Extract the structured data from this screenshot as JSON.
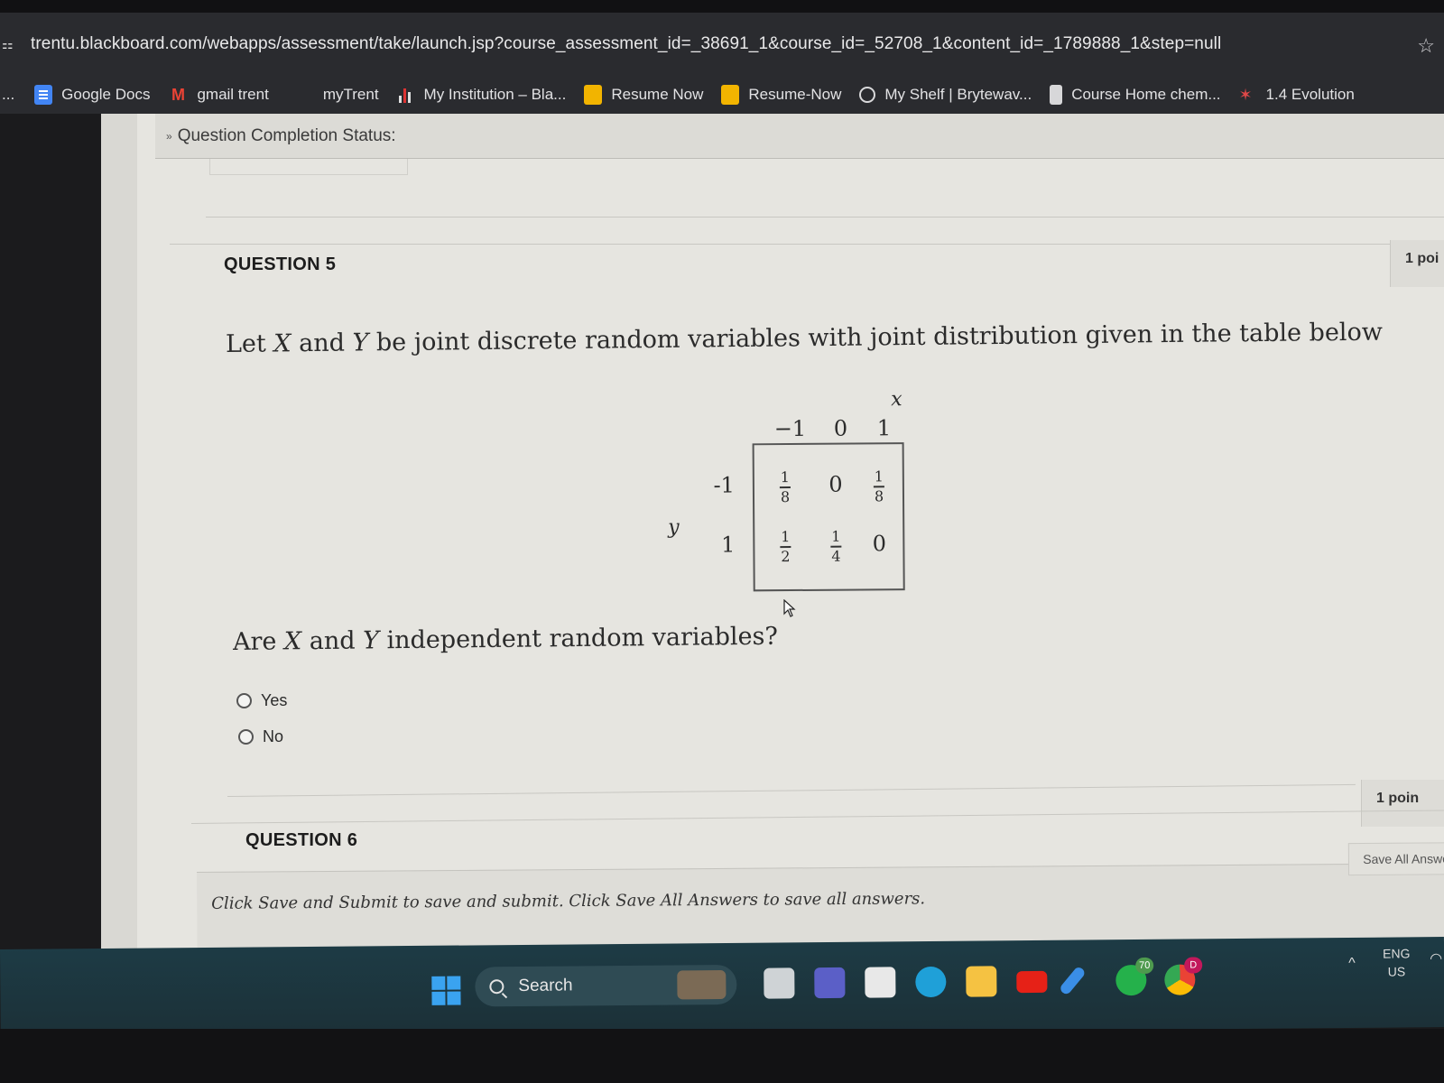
{
  "browser": {
    "url": "trentu.blackboard.com/webapps/assessment/take/launch.jsp?course_assessment_id=_38691_1&course_id=_52708_1&content_id=_1789888_1&step=null",
    "overflow_label": "..."
  },
  "bookmarks": [
    {
      "label": "Google Docs",
      "icon": "docs-icon"
    },
    {
      "label": "gmail trent",
      "icon": "gmail-icon"
    },
    {
      "label": "myTrent",
      "icon": ""
    },
    {
      "label": "My Institution – Bla...",
      "icon": "bars-icon"
    },
    {
      "label": "Resume Now",
      "icon": "resume-icon"
    },
    {
      "label": "Resume-Now",
      "icon": "resume-icon"
    },
    {
      "label": "My Shelf | Brytewav...",
      "icon": "globe-icon"
    },
    {
      "label": "Course Home chem...",
      "icon": "doc-icon"
    },
    {
      "label": "1.4 Evolution",
      "icon": "red-icon"
    }
  ],
  "page": {
    "status_label": "Question Completion Status:",
    "question5": {
      "heading": "QUESTION 5",
      "points": "1 poi",
      "prompt_parts": [
        "Let ",
        "X",
        " and ",
        "Y",
        " be joint discrete random variables with joint distribution given in the table below"
      ],
      "question_parts": [
        "Are ",
        "X",
        " and ",
        "Y",
        " independent random variables?"
      ],
      "options": [
        "Yes",
        "No"
      ],
      "table": {
        "x_var": "x",
        "y_var": "y",
        "x_values": [
          "−1",
          "0",
          "1"
        ],
        "y_values": [
          "-1",
          "1"
        ],
        "cells": [
          [
            {
              "num": "1",
              "den": "8"
            },
            {
              "value": "0"
            },
            {
              "num": "1",
              "den": "8"
            }
          ],
          [
            {
              "num": "1",
              "den": "2"
            },
            {
              "num": "1",
              "den": "4"
            },
            {
              "value": "0"
            }
          ]
        ]
      }
    },
    "question6": {
      "heading": "QUESTION 6",
      "points": "1 poin"
    },
    "instructions": "Click Save and Submit to save and submit. Click Save All Answers to save all answers.",
    "save_all_label": "Save All Answers"
  },
  "taskbar": {
    "search_label": "Search",
    "whatsapp_badge": "70",
    "chrome_badge": "D",
    "lang_top": "ENG",
    "lang_bottom": "US"
  },
  "colors": {
    "browser_chrome": "#2a2b2f",
    "page_bg": "#e6e5e0",
    "taskbar": "#1d3b45",
    "windows_blue": "#3aa3f0"
  }
}
